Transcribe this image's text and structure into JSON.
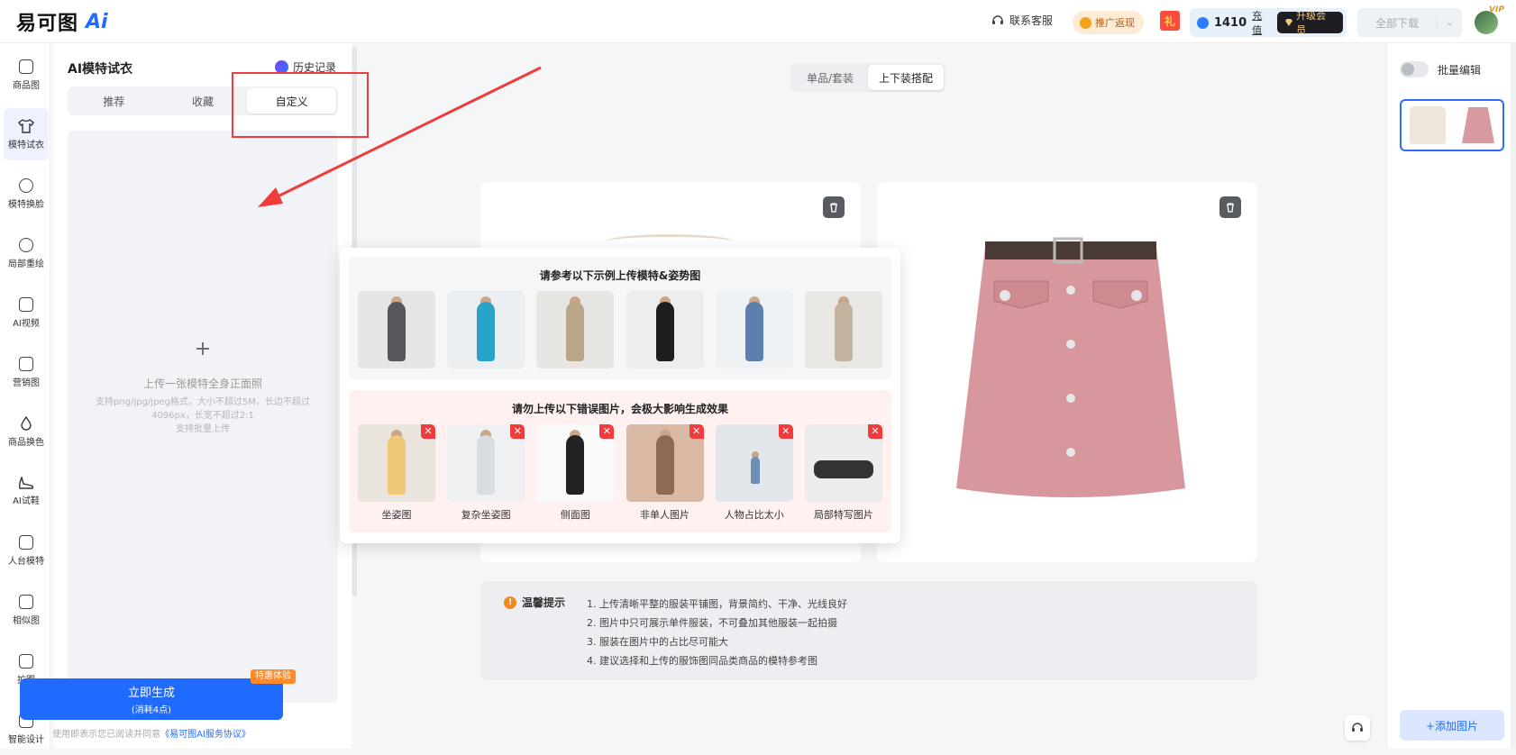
{
  "brand": {
    "name": "易可图",
    "ai": "Ai"
  },
  "topbar": {
    "contact": "联系客服",
    "promo": "推广返现",
    "gift": "礼",
    "balance": "1410",
    "recharge": "充值",
    "vip": "升级会员",
    "download": "全部下载",
    "vip_badge": "VIP"
  },
  "rail": {
    "items": [
      {
        "label": "商品图",
        "icon": "product-image-icon"
      },
      {
        "label": "模特试衣",
        "icon": "tshirt-icon"
      },
      {
        "label": "模特换脸",
        "icon": "face-swap-icon"
      },
      {
        "label": "局部重绘",
        "icon": "partial-redraw-icon"
      },
      {
        "label": "AI视频",
        "icon": "ai-video-icon"
      },
      {
        "label": "营销图",
        "icon": "marketing-image-icon"
      },
      {
        "label": "商品换色",
        "icon": "color-drop-icon"
      },
      {
        "label": "AI试鞋",
        "icon": "shoe-icon"
      },
      {
        "label": "人台模特",
        "icon": "mannequin-icon"
      },
      {
        "label": "相似图",
        "icon": "similar-image-icon"
      },
      {
        "label": "扩图",
        "icon": "expand-image-icon"
      },
      {
        "label": "智能设计",
        "icon": "smart-design-icon"
      }
    ]
  },
  "panel": {
    "title": "AI模特试衣",
    "history": "历史记录",
    "tabs": [
      {
        "label": "推荐"
      },
      {
        "label": "收藏"
      },
      {
        "label": "自定义"
      }
    ],
    "upload": {
      "plus": "+",
      "title": "上传一张模特全身正面照",
      "hint": "支持png/jpg/jpeg格式，大小不超过5M，长边不超过4096px，长宽不超过2:1",
      "hint2": "支持批量上传"
    },
    "generate": {
      "label": "立即生成",
      "cost": "(消耗4点)",
      "tag": "特惠体验"
    },
    "agreement": {
      "prefix": "使用即表示您已阅读并同意",
      "link": "《易可图AI服务协议》"
    }
  },
  "main": {
    "modes": [
      {
        "label": "单品/套装"
      },
      {
        "label": "上下装搭配"
      }
    ],
    "popover": {
      "good_title": "请参考以下示例上传模特&姿势图",
      "bad_title": "请勿上传以下错误图片，会极大影响生成效果",
      "bad_labels": [
        "坐姿图",
        "复杂坐姿图",
        "侧面图",
        "非单人图片",
        "人物占比太小",
        "局部特写图片"
      ]
    },
    "tips": {
      "title": "温馨提示",
      "items": [
        "1. 上传清晰平整的服装平铺图，背景简约、干净、光线良好",
        "2. 图片中只可展示单件服装，不可叠加其他服装一起拍摄",
        "3. 服装在图片中的占比尽可能大",
        "4. 建议选择和上传的服饰图同品类商品的模特参考图"
      ]
    }
  },
  "right": {
    "batch": "批量编辑",
    "add": "+添加图片"
  },
  "colors": {
    "accent": "#1f6bff",
    "annotation": "#f03c3c",
    "warning": "#f28a1b"
  }
}
